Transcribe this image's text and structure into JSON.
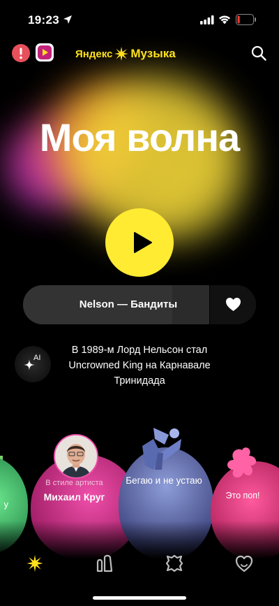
{
  "status_bar": {
    "time": "19:23",
    "battery_level": 0.15,
    "battery_color": "#ff3b30"
  },
  "header": {
    "brand_word1": "Яндекс",
    "brand_word2": "Музыка",
    "brand_color": "#ffe11e",
    "icons": [
      "alert-icon",
      "video-icon",
      "search-icon"
    ]
  },
  "main": {
    "title": "Моя волна",
    "accent_color": "#ffeb32"
  },
  "player": {
    "track": "Nelson — Бандиты",
    "progress": 0.8
  },
  "ai_fact": {
    "badge": "AI",
    "text": "В 1989-м Лорд Нельсон стал Uncrowned King на Карнавале Тринидада"
  },
  "vibes": [
    {
      "label": "у"
    },
    {
      "caption": "В стиле артиста",
      "label": "Михаил Круг"
    },
    {
      "label": "Бегаю и не устаю"
    },
    {
      "label": "Это поп!"
    }
  ],
  "tabs": [
    "tab-my-wave",
    "tab-collection",
    "tab-podcasts",
    "tab-favorites"
  ]
}
